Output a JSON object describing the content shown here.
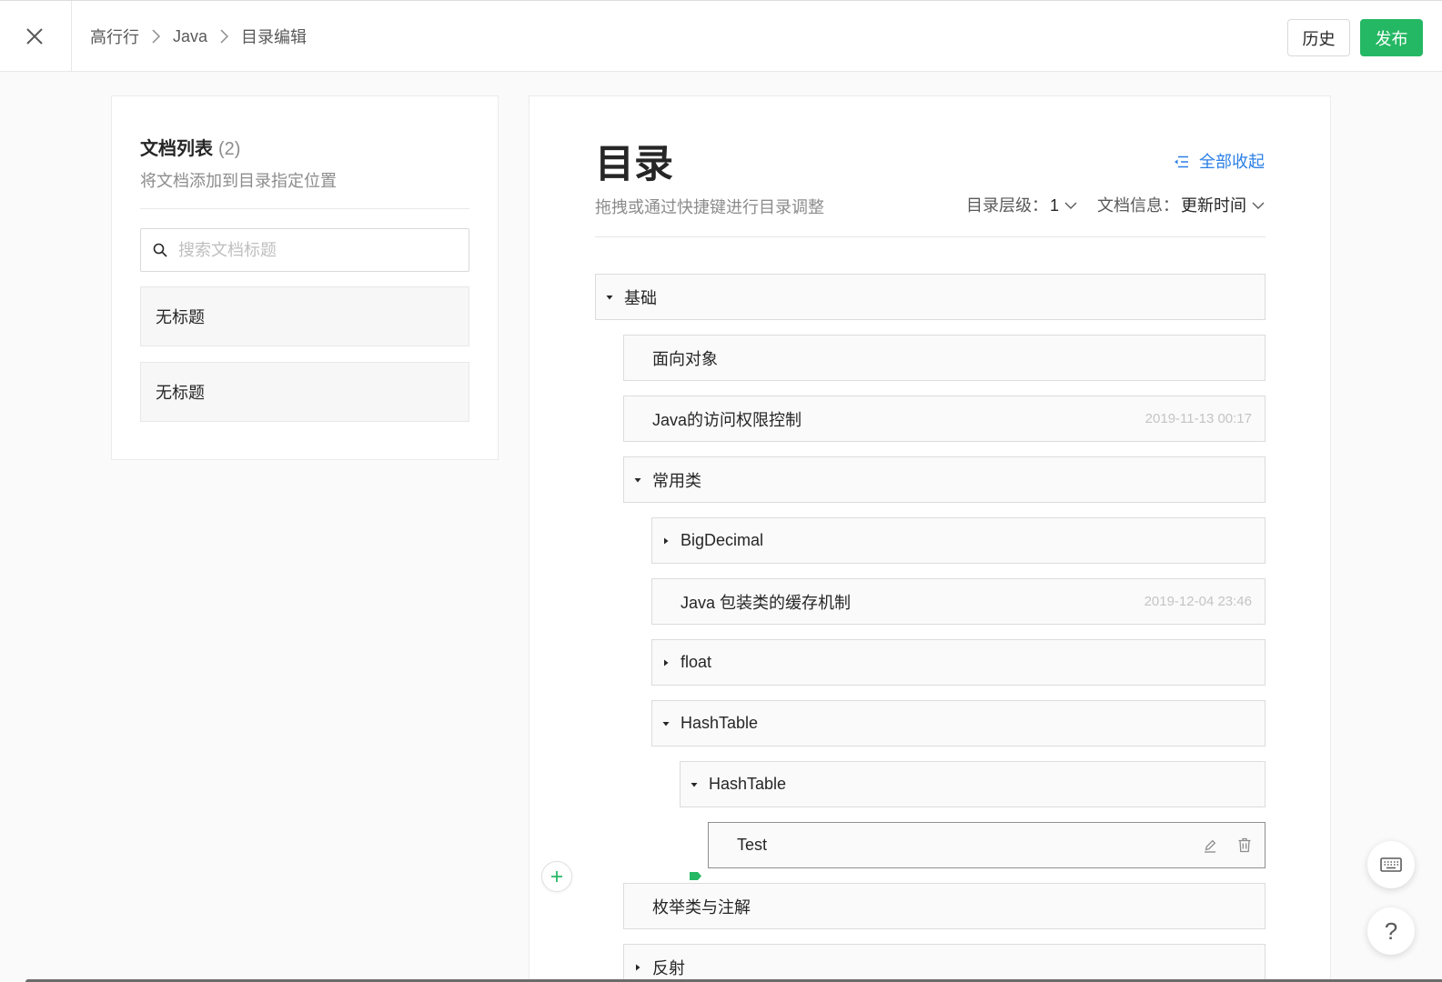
{
  "header": {
    "close_icon": "close-icon",
    "breadcrumb": [
      "高行行",
      "Java",
      "目录编辑"
    ],
    "breadcrumb_separator_icon": "chevron-right-icon",
    "history_label": "历史",
    "publish_label": "发布"
  },
  "doc_list": {
    "title": "文档列表",
    "count": "(2)",
    "subtitle": "将文档添加到目录指定位置",
    "search_icon": "search-icon",
    "search_placeholder": "搜索文档标题",
    "search_value": "",
    "items": [
      {
        "title": "无标题"
      },
      {
        "title": "无标题"
      }
    ]
  },
  "toc": {
    "title": "目录",
    "collapse_all_icon": "collapse-list-icon",
    "collapse_all_label": "全部收起",
    "subtitle": "拖拽或通过快捷键进行目录调整",
    "level_label": "目录层级：",
    "level_value": "1",
    "info_label": "文档信息：",
    "info_value": "更新时间",
    "items": [
      {
        "title": "基础",
        "level": 0,
        "caret": "down"
      },
      {
        "title": "面向对象",
        "level": 1,
        "caret": ""
      },
      {
        "title": "Java的访问权限控制",
        "level": 1,
        "caret": "",
        "date": "2019-11-13 00:17"
      },
      {
        "title": "常用类",
        "level": 1,
        "caret": "down"
      },
      {
        "title": "BigDecimal",
        "level": 2,
        "caret": "right"
      },
      {
        "title": "Java 包装类的缓存机制",
        "level": 2,
        "caret": "",
        "date": "2019-12-04 23:46"
      },
      {
        "title": "float",
        "level": 2,
        "caret": "right"
      },
      {
        "title": "HashTable",
        "level": 2,
        "caret": "down"
      },
      {
        "title": "HashTable",
        "level": 3,
        "caret": "down"
      },
      {
        "title": "Test",
        "level": 4,
        "caret": "",
        "selected": true,
        "actions": [
          "edit-icon",
          "delete-icon"
        ]
      },
      {
        "title": "枚举类与注解",
        "level": 1,
        "caret": ""
      },
      {
        "title": "反射",
        "level": 1,
        "caret": "right"
      }
    ],
    "add_icon": "plus-icon",
    "drop_indicator": "drop-marker-icon"
  },
  "floating": {
    "keyboard_icon": "keyboard-icon",
    "help_label": "?"
  },
  "colors": {
    "accent": "#25b864",
    "link": "#2a7fe6",
    "text": "#262626",
    "muted": "#8c8c8c"
  }
}
